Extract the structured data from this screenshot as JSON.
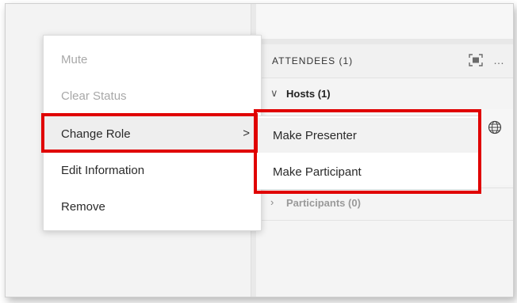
{
  "attendees_panel": {
    "title": "ATTENDEES (1)",
    "hosts_label": "Hosts (1)",
    "participants_label": "Participants (0)",
    "more_icon": "…",
    "icons": [
      "fullscreen-icon",
      "more-icon",
      "globe-icon"
    ]
  },
  "context_menu": {
    "items": [
      {
        "label": "Mute",
        "disabled": true
      },
      {
        "label": "Clear Status",
        "disabled": true
      },
      {
        "label": "Change Role",
        "disabled": false,
        "arrow": ">"
      },
      {
        "label": "Edit Information",
        "disabled": false
      },
      {
        "label": "Remove",
        "disabled": false
      }
    ]
  },
  "submenu": {
    "items": [
      {
        "label": "Make Presenter"
      },
      {
        "label": "Make Participant"
      }
    ]
  },
  "colors": {
    "highlight_red": "#e00000",
    "disabled_text": "#a8a8a8"
  }
}
